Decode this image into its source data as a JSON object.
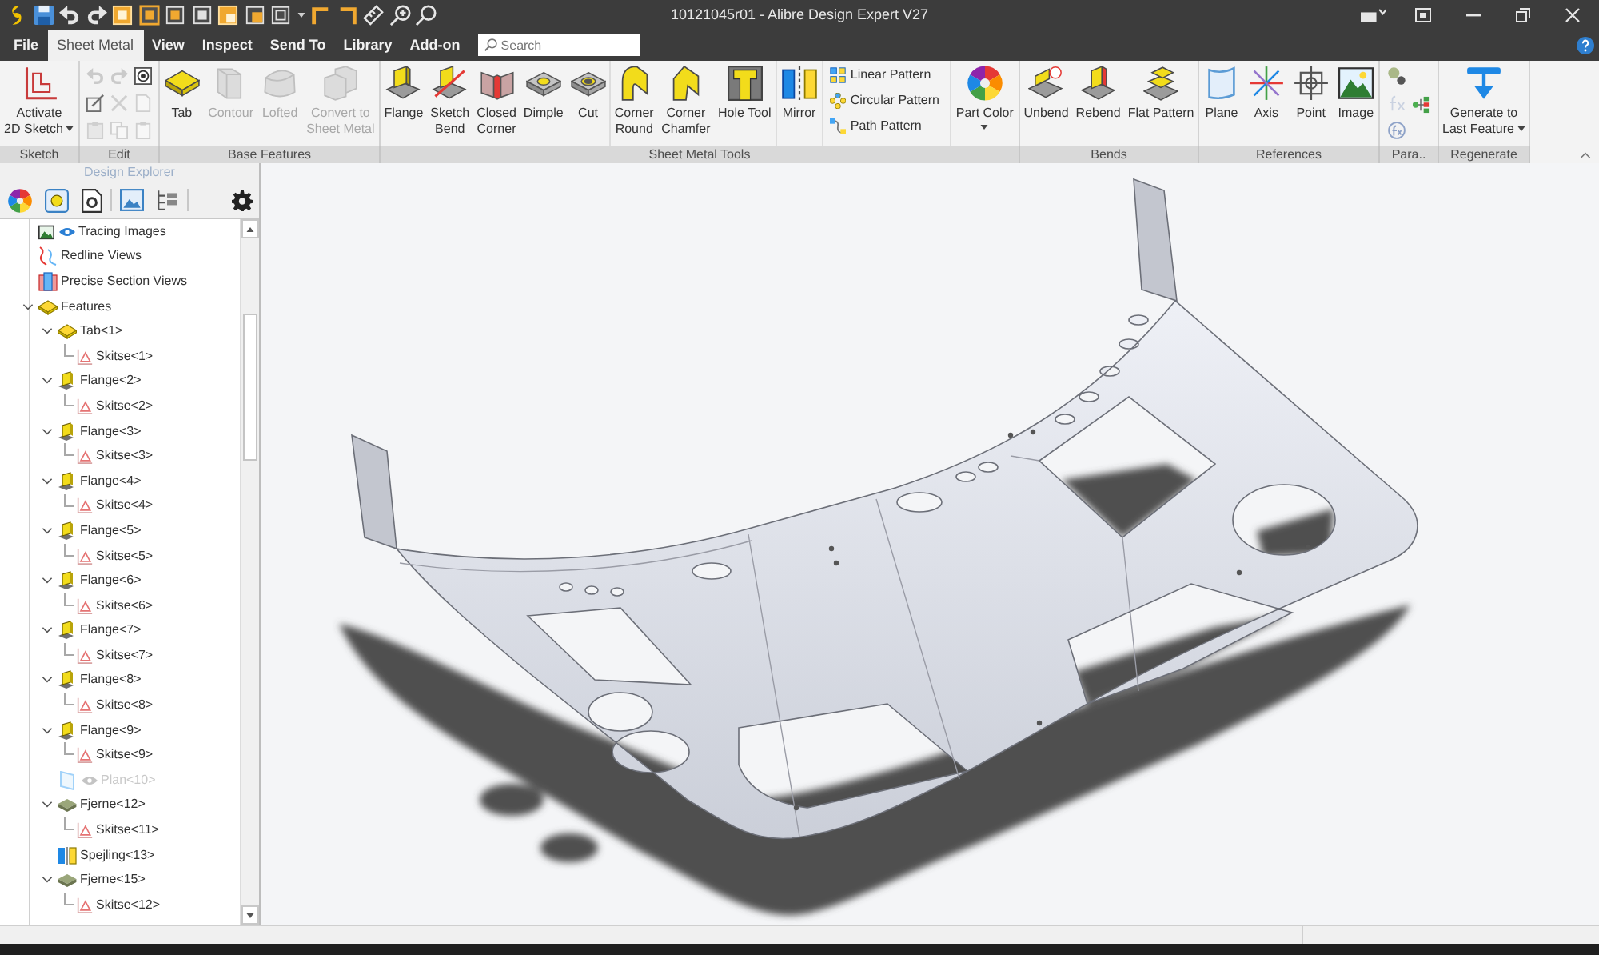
{
  "window": {
    "title": "10121045r01 - Alibre Design Expert V27"
  },
  "menu_tabs": [
    {
      "label": "File",
      "selected": false
    },
    {
      "label": "Sheet Metal",
      "selected": true
    },
    {
      "label": "View",
      "selected": false
    },
    {
      "label": "Inspect",
      "selected": false
    },
    {
      "label": "Send To",
      "selected": false
    },
    {
      "label": "Library",
      "selected": false
    },
    {
      "label": "Add-on",
      "selected": false
    }
  ],
  "search": {
    "placeholder": "Search"
  },
  "ribbon": [
    {
      "label": "Sketch",
      "sections": [
        [
          {
            "kind": "sketch",
            "label": [
              "Activate",
              "2D Sketch"
            ],
            "dropdown": true,
            "disabled": false
          }
        ]
      ]
    },
    {
      "label": "Edit",
      "sections": [
        [
          {
            "kind": "undo",
            "disabled": true
          },
          {
            "kind": "edit-box",
            "disabled": false
          },
          {
            "kind": "paste",
            "disabled": true
          },
          {
            "kind": "redo",
            "disabled": true
          },
          {
            "kind": "delete",
            "disabled": true
          },
          {
            "kind": "copy",
            "disabled": true
          },
          {
            "kind": "target",
            "disabled": false
          },
          {
            "kind": "duplicate",
            "disabled": true
          },
          {
            "kind": "clipboard",
            "disabled": true
          }
        ]
      ]
    },
    {
      "label": "Base Features",
      "sections": [
        [
          {
            "kind": "tab",
            "label": [
              "Tab"
            ],
            "disabled": false
          },
          {
            "kind": "contour",
            "label": [
              "Contour"
            ],
            "disabled": true
          },
          {
            "kind": "lofted",
            "label": [
              "Lofted"
            ],
            "disabled": true
          },
          {
            "kind": "convert",
            "label": [
              "Convert to",
              "Sheet Metal"
            ],
            "disabled": true
          }
        ]
      ]
    },
    {
      "label": "Sheet Metal Tools",
      "sections": [
        [
          {
            "kind": "flange",
            "label": [
              "Flange"
            ],
            "disabled": false
          },
          {
            "kind": "sketch-bend",
            "label": [
              "Sketch",
              "Bend"
            ],
            "disabled": false
          },
          {
            "kind": "closed-corner",
            "label": [
              "Closed",
              "Corner"
            ],
            "disabled": false
          },
          {
            "kind": "dimple",
            "label": [
              "Dimple"
            ],
            "disabled": false
          },
          {
            "kind": "cut",
            "label": [
              "Cut"
            ],
            "disabled": false
          }
        ],
        [
          {
            "kind": "corner-round",
            "label": [
              "Corner",
              "Round"
            ],
            "disabled": false
          },
          {
            "kind": "corner-chamfer",
            "label": [
              "Corner",
              "Chamfer"
            ],
            "disabled": false
          },
          {
            "kind": "hole-tool",
            "label": [
              "Hole Tool"
            ],
            "disabled": false
          }
        ],
        [
          {
            "kind": "mirror",
            "label": [
              "Mirror"
            ],
            "disabled": false
          }
        ],
        [
          {
            "kind": "linear-pattern",
            "label": [
              "Linear Pattern"
            ],
            "disabled": false
          },
          {
            "kind": "circular-pattern",
            "label": [
              "Circular Pattern"
            ],
            "disabled": false
          },
          {
            "kind": "path-pattern",
            "label": [
              "Path Pattern"
            ],
            "disabled": false
          }
        ],
        [
          {
            "kind": "part-color",
            "label": [
              "Part Color"
            ],
            "dropdown": true,
            "disabled": false
          }
        ]
      ]
    },
    {
      "label": "Bends",
      "sections": [
        [
          {
            "kind": "unbend",
            "label": [
              "Unbend"
            ],
            "disabled": false
          },
          {
            "kind": "rebend",
            "label": [
              "Rebend"
            ],
            "disabled": false
          },
          {
            "kind": "flat-pattern",
            "label": [
              "Flat Pattern"
            ],
            "disabled": false
          }
        ]
      ]
    },
    {
      "label": "References",
      "sections": [
        [
          {
            "kind": "plane",
            "label": [
              "Plane"
            ],
            "disabled": false
          },
          {
            "kind": "axis",
            "label": [
              "Axis"
            ],
            "disabled": false
          },
          {
            "kind": "point",
            "label": [
              "Point"
            ],
            "disabled": false
          },
          {
            "kind": "image",
            "label": [
              "Image"
            ],
            "disabled": false
          }
        ]
      ]
    },
    {
      "label": "Para..",
      "sections": [
        [
          {
            "kind": "parameter",
            "disabled": false
          },
          {
            "kind": "equation",
            "disabled": true
          },
          {
            "kind": "equation-alt",
            "disabled": false
          },
          {
            "kind": "hierarchy",
            "disabled": false
          }
        ]
      ]
    },
    {
      "label": "Regenerate",
      "sections": [
        [
          {
            "kind": "generate",
            "label": [
              "Generate to",
              "Last Feature"
            ],
            "dropdown": true,
            "disabled": false
          }
        ]
      ]
    }
  ],
  "design_explorer": {
    "title": "Design Explorer",
    "tree": [
      {
        "kind": "tracing",
        "label": "Tracing Images",
        "dimmed": false
      },
      {
        "kind": "redline",
        "label": "Redline Views",
        "dimmed": false
      },
      {
        "kind": "section",
        "label": "Precise Section Views",
        "dimmed": false
      },
      {
        "kind": "features",
        "label": "Features",
        "dimmed": false,
        "expanded": true,
        "children": [
          {
            "kind": "tab",
            "label": "Tab<1>",
            "dimmed": false,
            "expanded": true,
            "children": [
              {
                "kind": "sketch",
                "label": "Skitse<1>",
                "dimmed": false
              }
            ]
          },
          {
            "kind": "flange",
            "label": "Flange<2>",
            "dimmed": false,
            "expanded": true,
            "children": [
              {
                "kind": "sketch",
                "label": "Skitse<2>",
                "dimmed": false
              }
            ]
          },
          {
            "kind": "flange",
            "label": "Flange<3>",
            "dimmed": false,
            "expanded": true,
            "children": [
              {
                "kind": "sketch",
                "label": "Skitse<3>",
                "dimmed": false
              }
            ]
          },
          {
            "kind": "flange",
            "label": "Flange<4>",
            "dimmed": false,
            "expanded": true,
            "children": [
              {
                "kind": "sketch",
                "label": "Skitse<4>",
                "dimmed": false
              }
            ]
          },
          {
            "kind": "flange",
            "label": "Flange<5>",
            "dimmed": false,
            "expanded": true,
            "children": [
              {
                "kind": "sketch",
                "label": "Skitse<5>",
                "dimmed": false
              }
            ]
          },
          {
            "kind": "flange",
            "label": "Flange<6>",
            "dimmed": false,
            "expanded": true,
            "children": [
              {
                "kind": "sketch",
                "label": "Skitse<6>",
                "dimmed": false
              }
            ]
          },
          {
            "kind": "flange",
            "label": "Flange<7>",
            "dimmed": false,
            "expanded": true,
            "children": [
              {
                "kind": "sketch",
                "label": "Skitse<7>",
                "dimmed": false
              }
            ]
          },
          {
            "kind": "flange",
            "label": "Flange<8>",
            "dimmed": false,
            "expanded": true,
            "children": [
              {
                "kind": "sketch",
                "label": "Skitse<8>",
                "dimmed": false
              }
            ]
          },
          {
            "kind": "flange",
            "label": "Flange<9>",
            "dimmed": false,
            "expanded": true,
            "children": [
              {
                "kind": "sketch",
                "label": "Skitse<9>",
                "dimmed": false
              }
            ]
          },
          {
            "kind": "plane",
            "label": "Plan<10>",
            "dimmed": true
          },
          {
            "kind": "remove",
            "label": "Fjerne<12>",
            "dimmed": false,
            "expanded": true,
            "children": [
              {
                "kind": "sketch",
                "label": "Skitse<11>",
                "dimmed": false
              }
            ]
          },
          {
            "kind": "mirror",
            "label": "Spejling<13>",
            "dimmed": false
          },
          {
            "kind": "remove",
            "label": "Fjerne<15>",
            "dimmed": false,
            "expanded": true,
            "children": [
              {
                "kind": "sketch",
                "label": "Skitse<12>",
                "dimmed": false
              }
            ]
          }
        ]
      }
    ]
  }
}
